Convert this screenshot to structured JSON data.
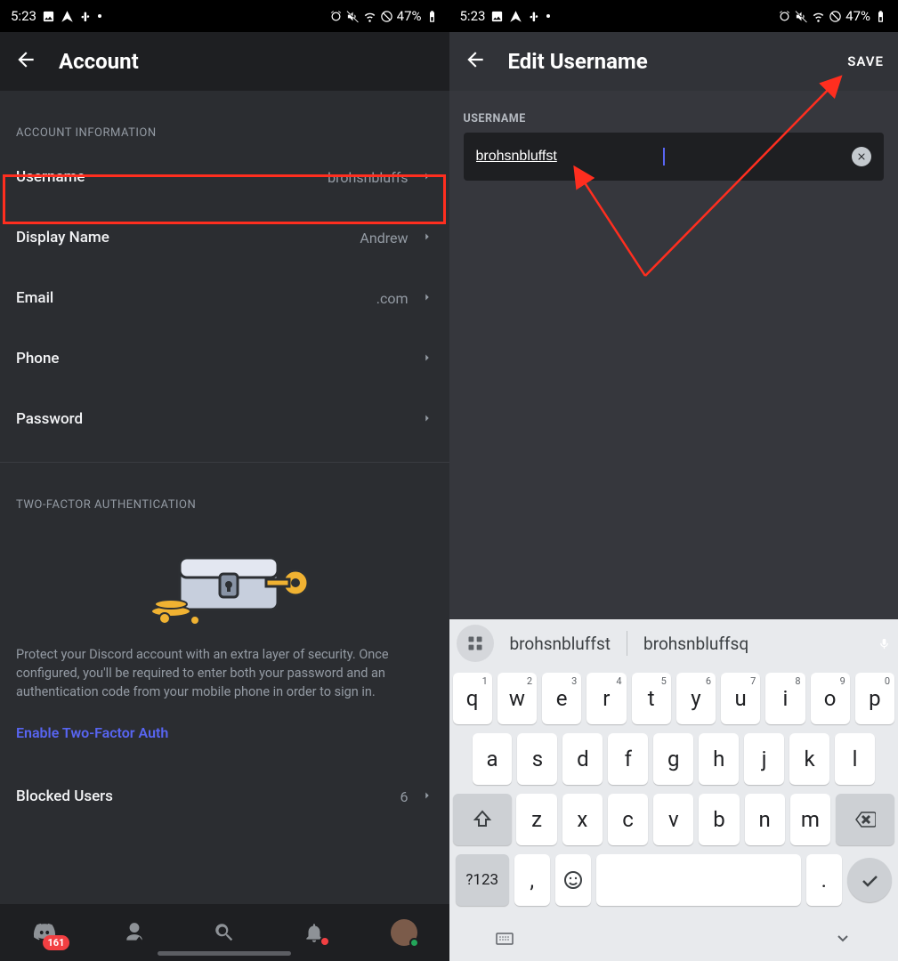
{
  "status": {
    "time": "5:23",
    "battery_text": "47%"
  },
  "left": {
    "title": "Account",
    "section_info": "ACCOUNT INFORMATION",
    "rows": {
      "username": {
        "label": "Username",
        "value": "brohsnbluffs"
      },
      "display": {
        "label": "Display Name",
        "value": "Andrew"
      },
      "email": {
        "label": "Email",
        "value": ".com"
      },
      "phone": {
        "label": "Phone",
        "value": ""
      },
      "password": {
        "label": "Password",
        "value": ""
      }
    },
    "section_2fa": "TWO-FACTOR AUTHENTICATION",
    "twofa_text": "Protect your Discord account with an extra layer of security. Once configured, you'll be required to enter both your password and an authentication code from your mobile phone in order to sign in.",
    "enable_2fa": "Enable Two-Factor Auth",
    "blocked": {
      "label": "Blocked Users",
      "value": "6"
    },
    "nav_badge": "161"
  },
  "right": {
    "title": "Edit Username",
    "save": "SAVE",
    "field_label": "USERNAME",
    "field_value": "brohsnbluffst",
    "suggestions": [
      "brohsnbluffst",
      "brohsnbluffsq"
    ],
    "kb_row1": [
      "q",
      "w",
      "e",
      "r",
      "t",
      "y",
      "u",
      "i",
      "o",
      "p"
    ],
    "kb_row1_sup": [
      "1",
      "2",
      "3",
      "4",
      "5",
      "6",
      "7",
      "8",
      "9",
      "0"
    ],
    "kb_row2": [
      "a",
      "s",
      "d",
      "f",
      "g",
      "h",
      "j",
      "k",
      "l"
    ],
    "kb_row3": [
      "z",
      "x",
      "c",
      "v",
      "b",
      "n",
      "m"
    ],
    "kb_sym": "?123",
    "kb_comma": ",",
    "kb_period": "."
  }
}
